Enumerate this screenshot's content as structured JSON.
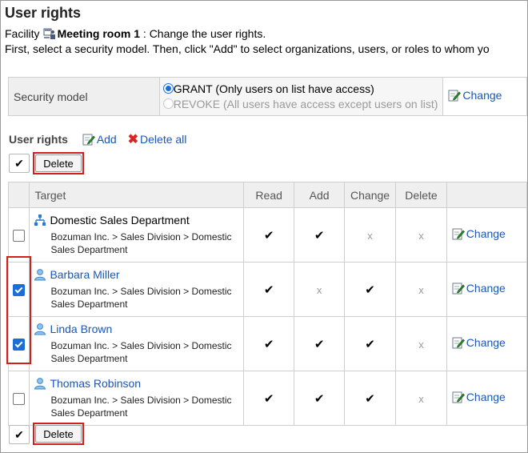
{
  "page": {
    "title": "User rights",
    "facility_label": "Facility",
    "facility_name": "Meeting room 1",
    "facility_suffix": ": Change the user rights.",
    "instruction": "First, select a security model. Then, click \"Add\" to select organizations, users, or roles to whom yo"
  },
  "security": {
    "label": "Security model",
    "grant": "GRANT (Only users on list have access)",
    "revoke": "REVOKE (All users have access except users on list)",
    "change": "Change"
  },
  "rights": {
    "title": "User rights",
    "add": "Add",
    "delete_all": "Delete all",
    "delete_button": "Delete",
    "check_all": "✔",
    "headers": {
      "target": "Target",
      "read": "Read",
      "add": "Add",
      "change": "Change",
      "delete": "Delete"
    },
    "change_link": "Change",
    "yes_mark": "✔",
    "no_mark": "x",
    "rows": [
      {
        "name": "Domestic Sales Department",
        "type": "organization",
        "path": "Bozuman Inc. > Sales Division > Domestic Sales Department",
        "checked": false,
        "read": true,
        "add": true,
        "change": false,
        "delete": false
      },
      {
        "name": "Barbara Miller",
        "type": "user",
        "path": "Bozuman Inc. > Sales Division > Domestic Sales Department",
        "checked": true,
        "read": true,
        "add": false,
        "change": true,
        "delete": false
      },
      {
        "name": "Linda Brown",
        "type": "user",
        "path": "Bozuman Inc. > Sales Division > Domestic Sales Department",
        "checked": true,
        "read": true,
        "add": true,
        "change": true,
        "delete": false
      },
      {
        "name": "Thomas Robinson",
        "type": "user",
        "path": "Bozuman Inc. > Sales Division > Domestic Sales Department",
        "checked": false,
        "read": true,
        "add": true,
        "change": true,
        "delete": false
      }
    ]
  },
  "colors": {
    "link": "#1a56b8",
    "highlight": "#d0201e",
    "checkbox": "#1a6ed8"
  }
}
